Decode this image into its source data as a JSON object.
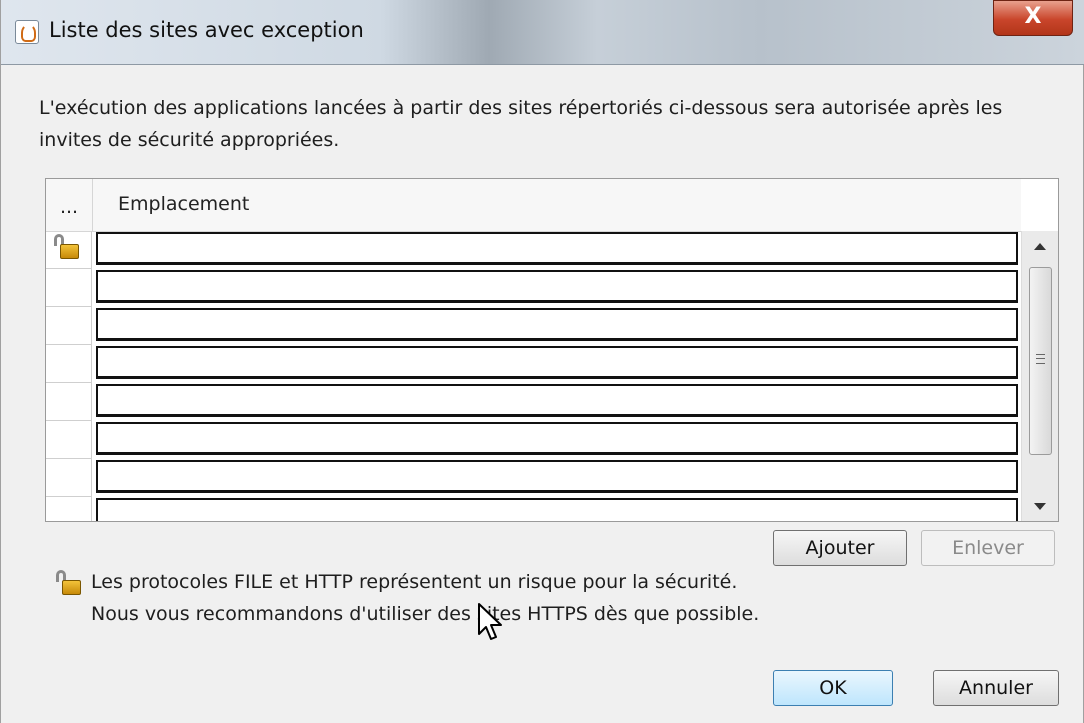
{
  "window": {
    "title": "Liste des sites avec exception",
    "close_glyph": "X",
    "icon": "java-icon"
  },
  "description": "L'exécution des applications lancées à partir des sites répertoriés ci-dessous sera autorisée après les invites de sécurité appropriées.",
  "table": {
    "col_marker": "...",
    "col_location": "Emplacement",
    "rows": [
      {
        "value": "",
        "icon": "unlocked-lock-icon"
      },
      {
        "value": ""
      },
      {
        "value": ""
      },
      {
        "value": ""
      },
      {
        "value": ""
      },
      {
        "value": ""
      },
      {
        "value": ""
      },
      {
        "value": ""
      }
    ]
  },
  "buttons": {
    "add": "Ajouter",
    "remove": "Enlever",
    "ok": "OK",
    "cancel": "Annuler"
  },
  "warning": {
    "line1": "Les protocoles FILE et HTTP représentent un risque pour la sécurité.",
    "line2": "Nous vous recommandons d'utiliser des sites HTTPS dès que possible.",
    "icon": "unlocked-lock-icon"
  }
}
